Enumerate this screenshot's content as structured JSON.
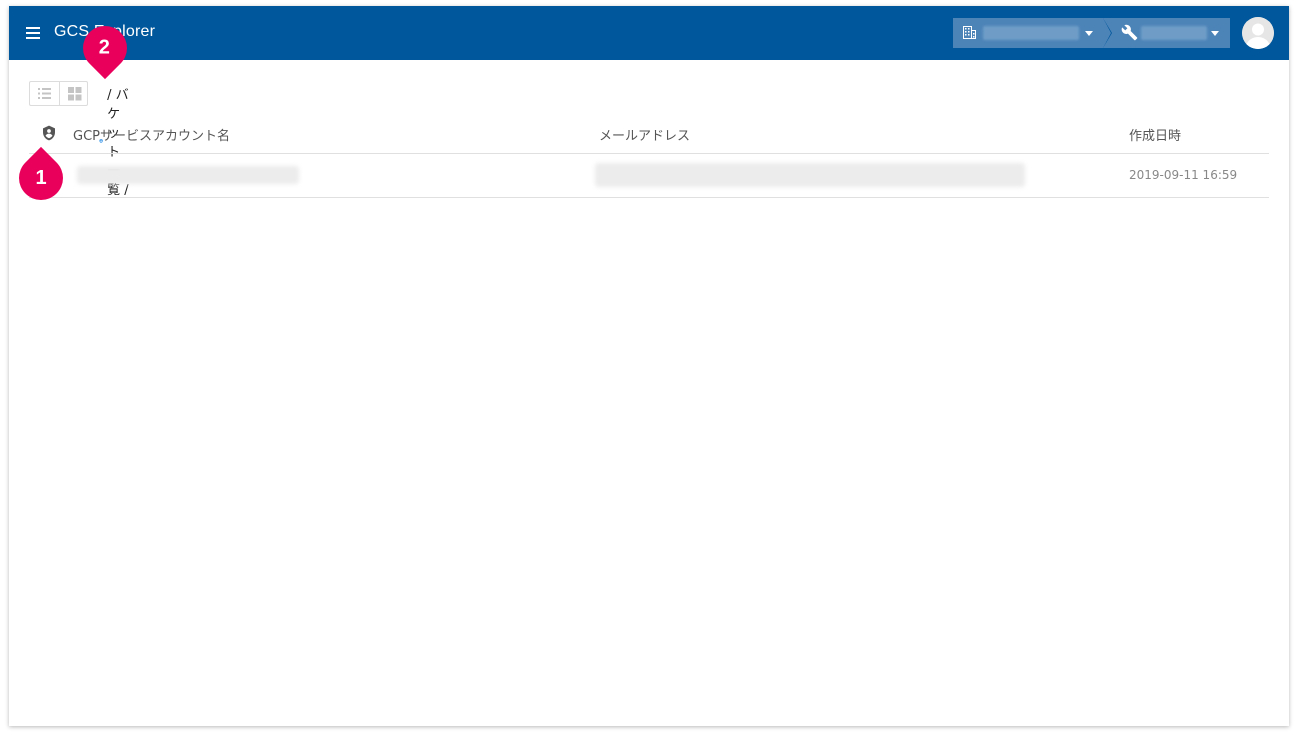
{
  "app": {
    "title": "GCS Explorer"
  },
  "header": {
    "menu_icon": "hamburger-menu-icon",
    "org_selector": {
      "icon": "building-icon"
    },
    "project_selector": {
      "icon": "wrench-icon"
    },
    "avatar_icon": "user-avatar-icon"
  },
  "toolbar": {
    "list_view_icon": "list-view-icon",
    "grid_view_icon": "grid-view-icon"
  },
  "breadcrumb": {
    "home_icon": "shield-account-icon",
    "path": " / バケット一覧 /"
  },
  "table": {
    "header_icon": "shield-account-icon",
    "columns": [
      "GCPサービスアカウント名",
      "メールアドレス",
      "作成日時"
    ],
    "rows": [
      {
        "created": "2019-09-11 16:59"
      }
    ]
  },
  "annotations": {
    "callout_1": "1",
    "callout_2": "2"
  },
  "colors": {
    "appbar": "#01579b",
    "selector": "#4d84b8",
    "callout": "#e8005a",
    "breadcrumb_icon": "#1e88e5"
  }
}
